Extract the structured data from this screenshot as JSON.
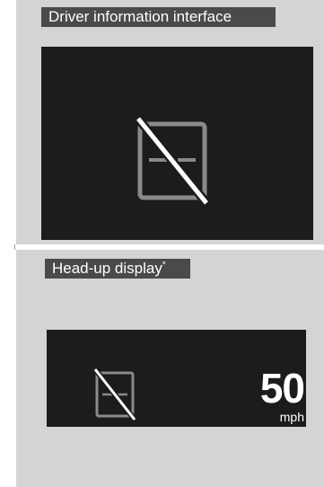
{
  "sections": {
    "top": {
      "label": "Driver information interface"
    },
    "bottom": {
      "label": "Head-up display",
      "label_mark": "*"
    }
  },
  "hud": {
    "speed_value": "50",
    "speed_unit": "mph"
  },
  "icons": {
    "top": "lane-keeping-off-icon",
    "bottom": "lane-keeping-off-icon"
  },
  "colors": {
    "panel": "#d4d4d4",
    "label_bg": "#4a4a4a",
    "screen": "#1c1c1c",
    "icon_gray": "#8a8a8a",
    "slash": "#ffffff"
  }
}
